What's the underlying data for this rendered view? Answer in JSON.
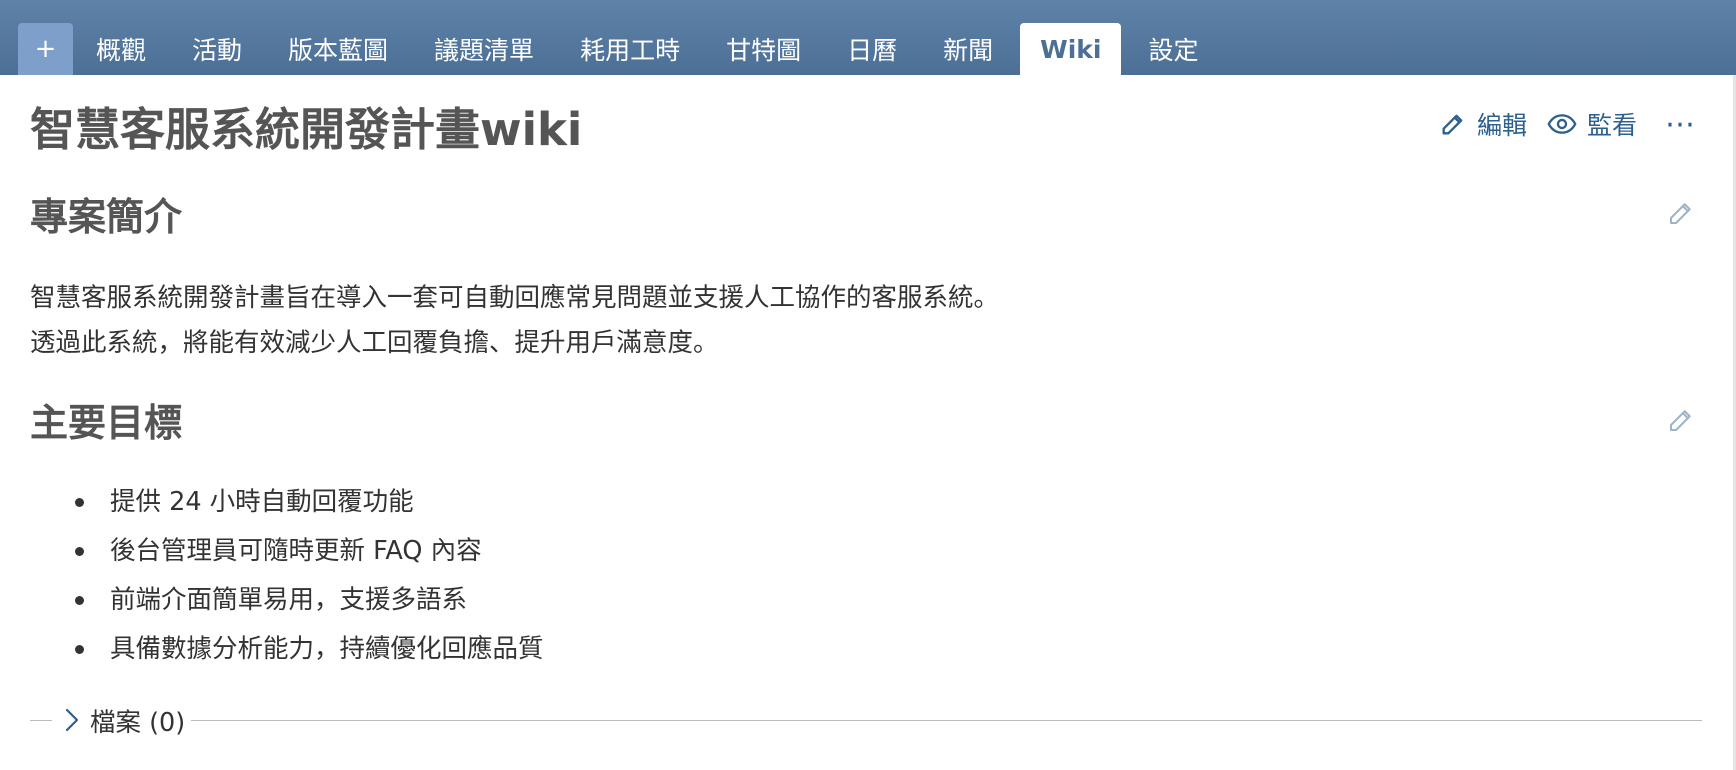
{
  "tabs": {
    "new_label": "+",
    "items": [
      "概觀",
      "活動",
      "版本藍圖",
      "議題清單",
      "耗用工時",
      "甘特圖",
      "日曆",
      "新聞",
      "Wiki",
      "設定"
    ],
    "active": "Wiki"
  },
  "page": {
    "title": "智慧客服系統開發計畫wiki"
  },
  "actions": {
    "edit_label": "編輯",
    "watch_label": "監看",
    "more_label": "⋯"
  },
  "sections": {
    "intro": {
      "heading": "專案簡介",
      "lines": [
        "智慧客服系統開發計畫旨在導入一套可自動回應常見問題並支援人工協作的客服系統。",
        "透過此系統，將能有效減少人工回覆負擔、提升用戶滿意度。"
      ]
    },
    "goals": {
      "heading": "主要目標",
      "items": [
        "提供 24 小時自動回覆功能",
        "後台管理員可隨時更新 FAQ 內容",
        "前端介面簡單易用，支援多語系",
        "具備數據分析能力，持續優化回應品質"
      ]
    }
  },
  "files": {
    "label": "檔案 (0)"
  },
  "colors": {
    "header": "#5f82a8",
    "accent": "#2d5f8f",
    "plus_tab": "#7f9fcb"
  },
  "icons": {
    "edit": "pencil-icon",
    "watch": "eye-icon",
    "more": "more-icon",
    "files_toggle": "chevron-right-icon"
  }
}
